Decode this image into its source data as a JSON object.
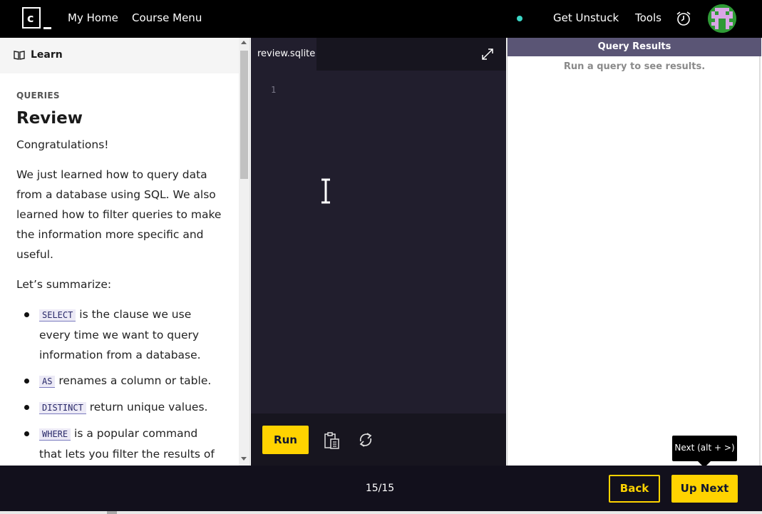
{
  "colors": {
    "topbar": "#000000",
    "accent_yellow": "#ffd300",
    "editor_bg": "#211e2d",
    "results_header": "#5a5575",
    "status_dot": "#3bd6c6"
  },
  "topbar": {
    "logo_letter": "c",
    "links": [
      {
        "label": "My Home"
      },
      {
        "label": "Course Menu"
      },
      {
        "label": "Get Unstuck"
      },
      {
        "label": "Tools"
      }
    ],
    "icons": [
      "status-dot",
      "alarm-clock-icon",
      "avatar"
    ]
  },
  "learn": {
    "header_label": "Learn",
    "breadcrumb": "QUERIES",
    "title": "Review",
    "paragraphs": [
      "Congratulations!",
      "We just learned how to query data from a database using SQL. We also learned how to filter queries to make the information more specific and useful.",
      "Let’s summarize:"
    ],
    "bullets": [
      {
        "code": "SELECT",
        "text": " is the clause we use every time we want to query information from a database."
      },
      {
        "code": "AS",
        "text": " renames a column or table."
      },
      {
        "code": "DISTINCT",
        "text": " return unique values."
      },
      {
        "code": "WHERE",
        "text": " is a popular command that lets you filter the results of"
      }
    ]
  },
  "editor": {
    "tab_name": "review.sqlite",
    "line_numbers": [
      "1"
    ],
    "run_label": "Run"
  },
  "results": {
    "header": "Query Results",
    "empty_text": "Run a query to see results."
  },
  "footer": {
    "progress": "15/15",
    "back_label": "Back",
    "next_label": "Up Next",
    "tooltip": "Next (alt + >)"
  }
}
